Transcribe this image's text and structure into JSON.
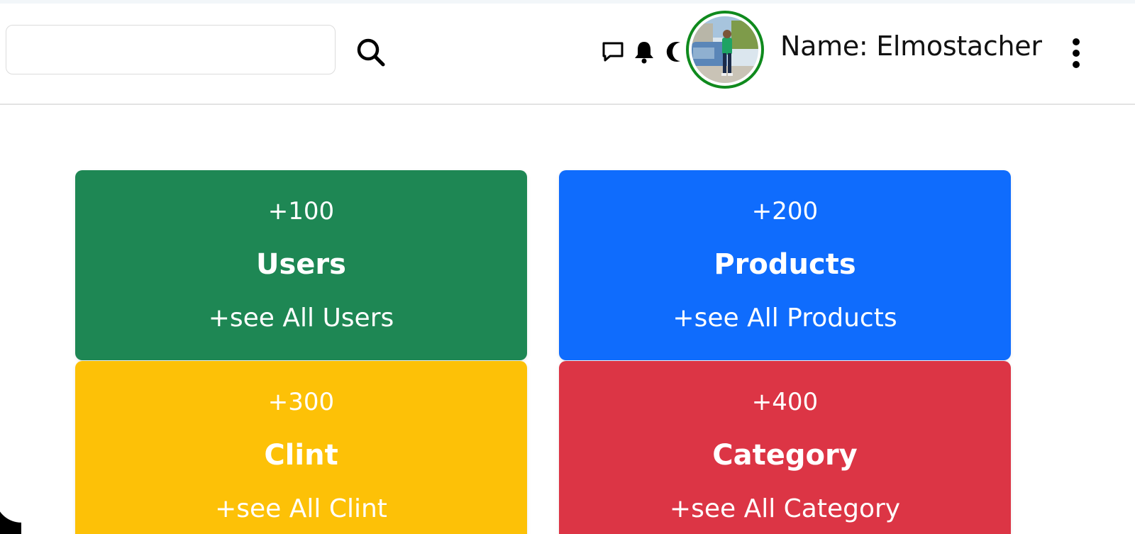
{
  "header": {
    "search": {
      "value": "",
      "placeholder": ""
    },
    "user_name": "Name: Elmostacher"
  },
  "icons": {
    "search": "search-icon",
    "messages": "chat-bubble-icon",
    "notifications": "bell-icon",
    "theme": "moon-icon",
    "menu": "kebab-menu-icon"
  },
  "colors": {
    "avatar_ring": "#0f8a1d",
    "users": "#1e8754",
    "products": "#0f6cfd",
    "clint": "#fdc107",
    "category": "#dc3545"
  },
  "cards": [
    {
      "count": "+100",
      "title": "Users",
      "link": "+see All Users"
    },
    {
      "count": "+200",
      "title": "Products",
      "link": "+see All Products"
    },
    {
      "count": "+300",
      "title": "Clint",
      "link": "+see All Clint"
    },
    {
      "count": "+400",
      "title": "Category",
      "link": "+see All Category"
    }
  ]
}
